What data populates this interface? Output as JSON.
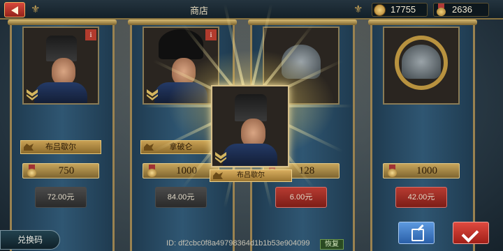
{
  "header": {
    "title": "商店",
    "gold": "17755",
    "medals": "2636"
  },
  "items": [
    {
      "name": "布吕歇尔",
      "price": "750",
      "buy_label": "72.00元",
      "buy_style": "grey",
      "has_info": true,
      "portrait": "hussar-general"
    },
    {
      "name": "拿破仑",
      "price": "1000",
      "buy_label": "84.00元",
      "buy_style": "grey",
      "has_info": true,
      "portrait": "napoleon"
    },
    {
      "name": "",
      "price": "128",
      "buy_label": "6.00元",
      "buy_style": "red",
      "has_info": false,
      "portrait": "helmet"
    },
    {
      "name": "",
      "price": "1000",
      "buy_label": "42.00元",
      "buy_style": "red",
      "has_info": false,
      "portrait": "helmet-wreath"
    }
  ],
  "highlight": {
    "name": "布吕歇尔"
  },
  "footer": {
    "redeem_label": "兑换码",
    "id_text": "ID: df2cbc0f8a49798364d1b1b53e904099",
    "restore_label": "恢复"
  }
}
